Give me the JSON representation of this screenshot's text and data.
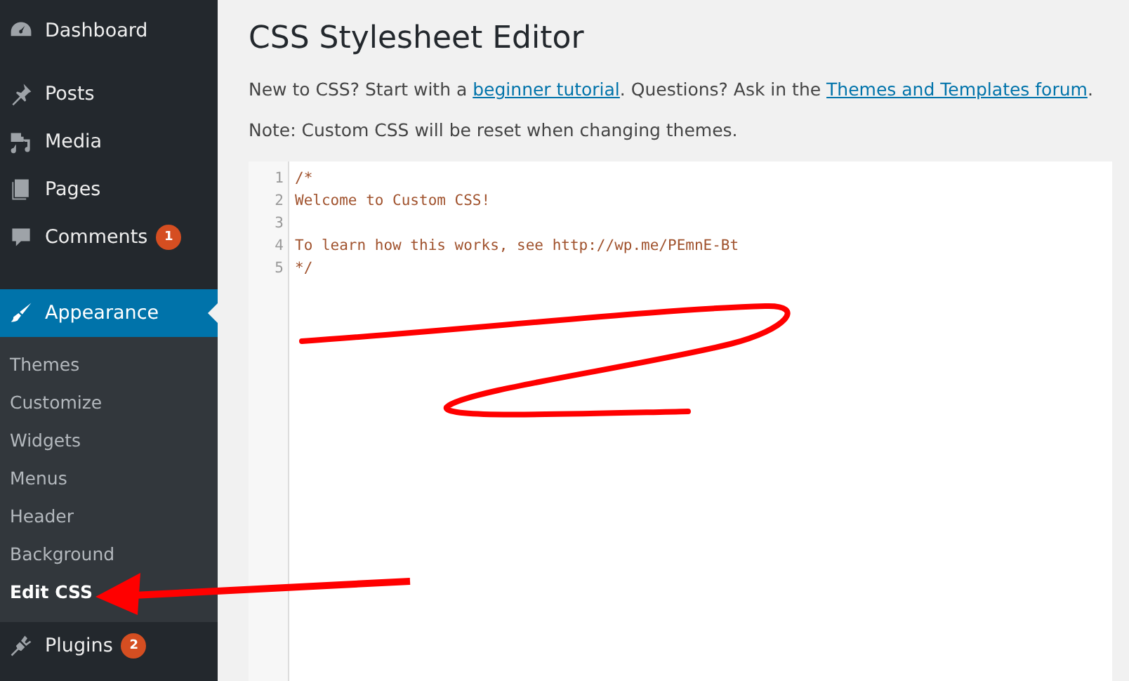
{
  "sidebar": {
    "menu_groups": [
      [
        {
          "label": "Dashboard",
          "selected": false
        }
      ],
      [
        {
          "label": "Posts",
          "selected": false
        },
        {
          "label": "Media",
          "selected": false
        },
        {
          "label": "Pages",
          "selected": false
        },
        {
          "label": "Comments",
          "selected": false,
          "badge": "1"
        }
      ],
      [
        {
          "label": "Appearance",
          "selected": true,
          "children": [
            {
              "label": "Themes",
              "selected": false
            },
            {
              "label": "Customize",
              "selected": false
            },
            {
              "label": "Widgets",
              "selected": false
            },
            {
              "label": "Menus",
              "selected": false
            },
            {
              "label": "Header",
              "selected": false
            },
            {
              "label": "Background",
              "selected": false
            },
            {
              "label": "Edit CSS",
              "selected": true
            }
          ]
        },
        {
          "label": "Plugins",
          "selected": false,
          "badge": "2"
        }
      ]
    ]
  },
  "page": {
    "title": "CSS Stylesheet Editor",
    "intro": {
      "before": "New to CSS? Start with a ",
      "link_1": "beginner tutorial",
      "middle": ". Questions? Ask in the ",
      "link_2": "Themes and Templates forum",
      "after": "."
    },
    "note": "Note: Custom CSS will be reset when changing themes."
  },
  "editor": {
    "lines": [
      {
        "number": "1",
        "text": "/*"
      },
      {
        "number": "2",
        "text": "Welcome to Custom CSS!"
      },
      {
        "number": "3"
      },
      {
        "number": "4",
        "text": "To learn how this works, see http://wp.me/PEmnE-Bt"
      },
      {
        "number": "5",
        "text": "*/"
      }
    ]
  }
}
